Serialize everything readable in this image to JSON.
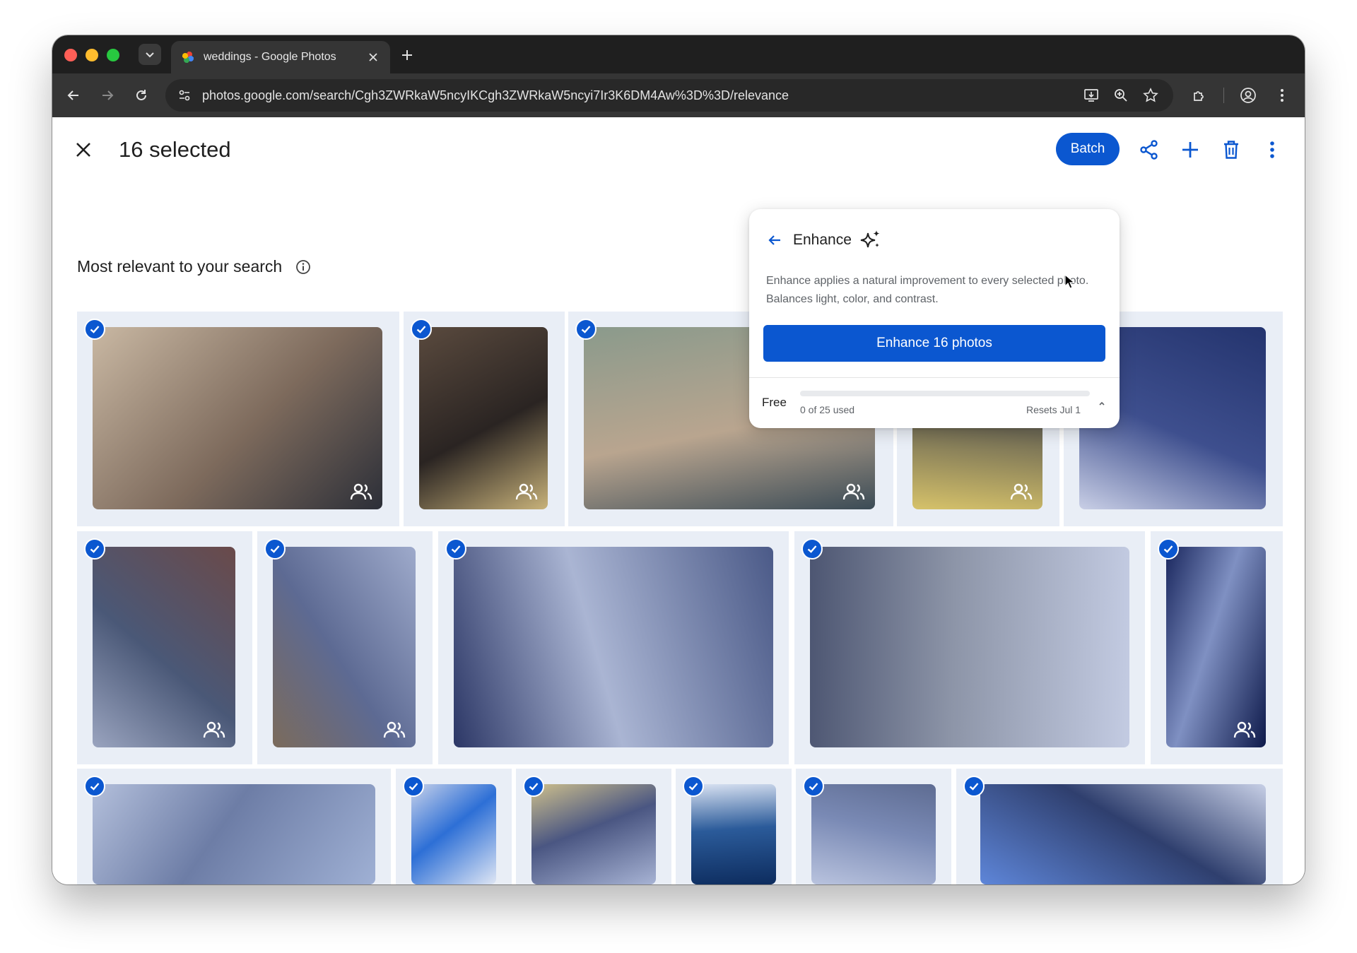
{
  "browser": {
    "tab_title": "weddings - Google Photos",
    "url": "photos.google.com/search/Cgh3ZWRkaW5ncyIKCgh3ZWRkaW5ncyi7Ir3K6DM4Aw%3D%3D/relevance"
  },
  "header": {
    "selected_label": "16 selected",
    "batch_label": "Batch"
  },
  "section": {
    "title": "Most relevant to your search"
  },
  "enhance": {
    "title": "Enhance",
    "description": "Enhance applies a natural improvement to every selected photo. Balances light, color, and contrast.",
    "cta_label": "Enhance 16 photos",
    "plan_label": "Free",
    "usage_label": "0 of 25 used",
    "usage_fraction": 0,
    "reset_label": "Resets Jul 1"
  },
  "icons": {
    "close": "close-icon",
    "share": "share-icon",
    "add": "add-icon",
    "trash": "trash-icon",
    "more": "more-vert-icon",
    "info": "info-icon",
    "back": "arrow-back-icon",
    "sparkle": "sparkle-icon",
    "check": "check-icon",
    "people": "people-icon"
  },
  "colors": {
    "accent": "#0b57d0",
    "cell_bg": "#e9eef6",
    "chrome_dark": "#1f1f1f"
  }
}
